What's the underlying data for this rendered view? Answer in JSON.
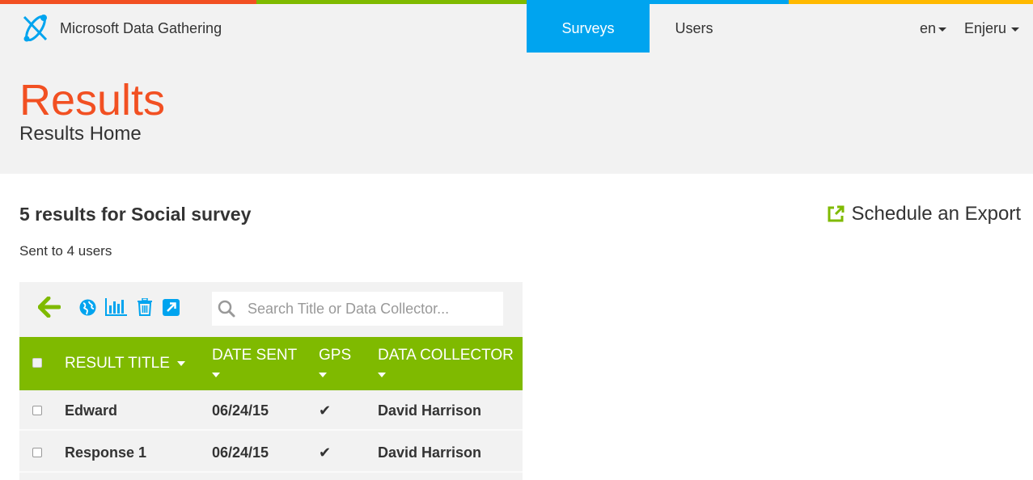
{
  "colors": {
    "stripe": [
      "#f25022",
      "#7fba00",
      "#00a4ef",
      "#ffb900"
    ],
    "accent_blue": "#00a4ef",
    "accent_green": "#7fba00",
    "title_orange": "#f25022"
  },
  "brand": {
    "name": "Microsoft Data Gathering",
    "icon": "app-logo-icon"
  },
  "nav": {
    "tabs": [
      {
        "label": "Surveys",
        "active": true
      },
      {
        "label": "Users",
        "active": false
      }
    ],
    "language": "en",
    "user": "Enjeru"
  },
  "page": {
    "title": "Results",
    "subtitle": "Results Home"
  },
  "results": {
    "heading": "5 results for Social survey",
    "sent_to": "Sent to 4 users",
    "export_label": "Schedule an Export"
  },
  "toolbar": {
    "icons": [
      "back-arrow-icon",
      "globe-icon",
      "bar-chart-icon",
      "trash-icon",
      "expand-icon"
    ],
    "search_placeholder": "Search Title or Data Collector..."
  },
  "table": {
    "columns": [
      "RESULT TITLE",
      "DATE SENT",
      "GPS",
      "DATA COLLECTOR"
    ],
    "rows": [
      {
        "title": "Edward",
        "date": "06/24/15",
        "gps": "✔",
        "collector": "David Harrison"
      },
      {
        "title": "Response 1",
        "date": "06/24/15",
        "gps": "✔",
        "collector": "David Harrison"
      }
    ]
  }
}
